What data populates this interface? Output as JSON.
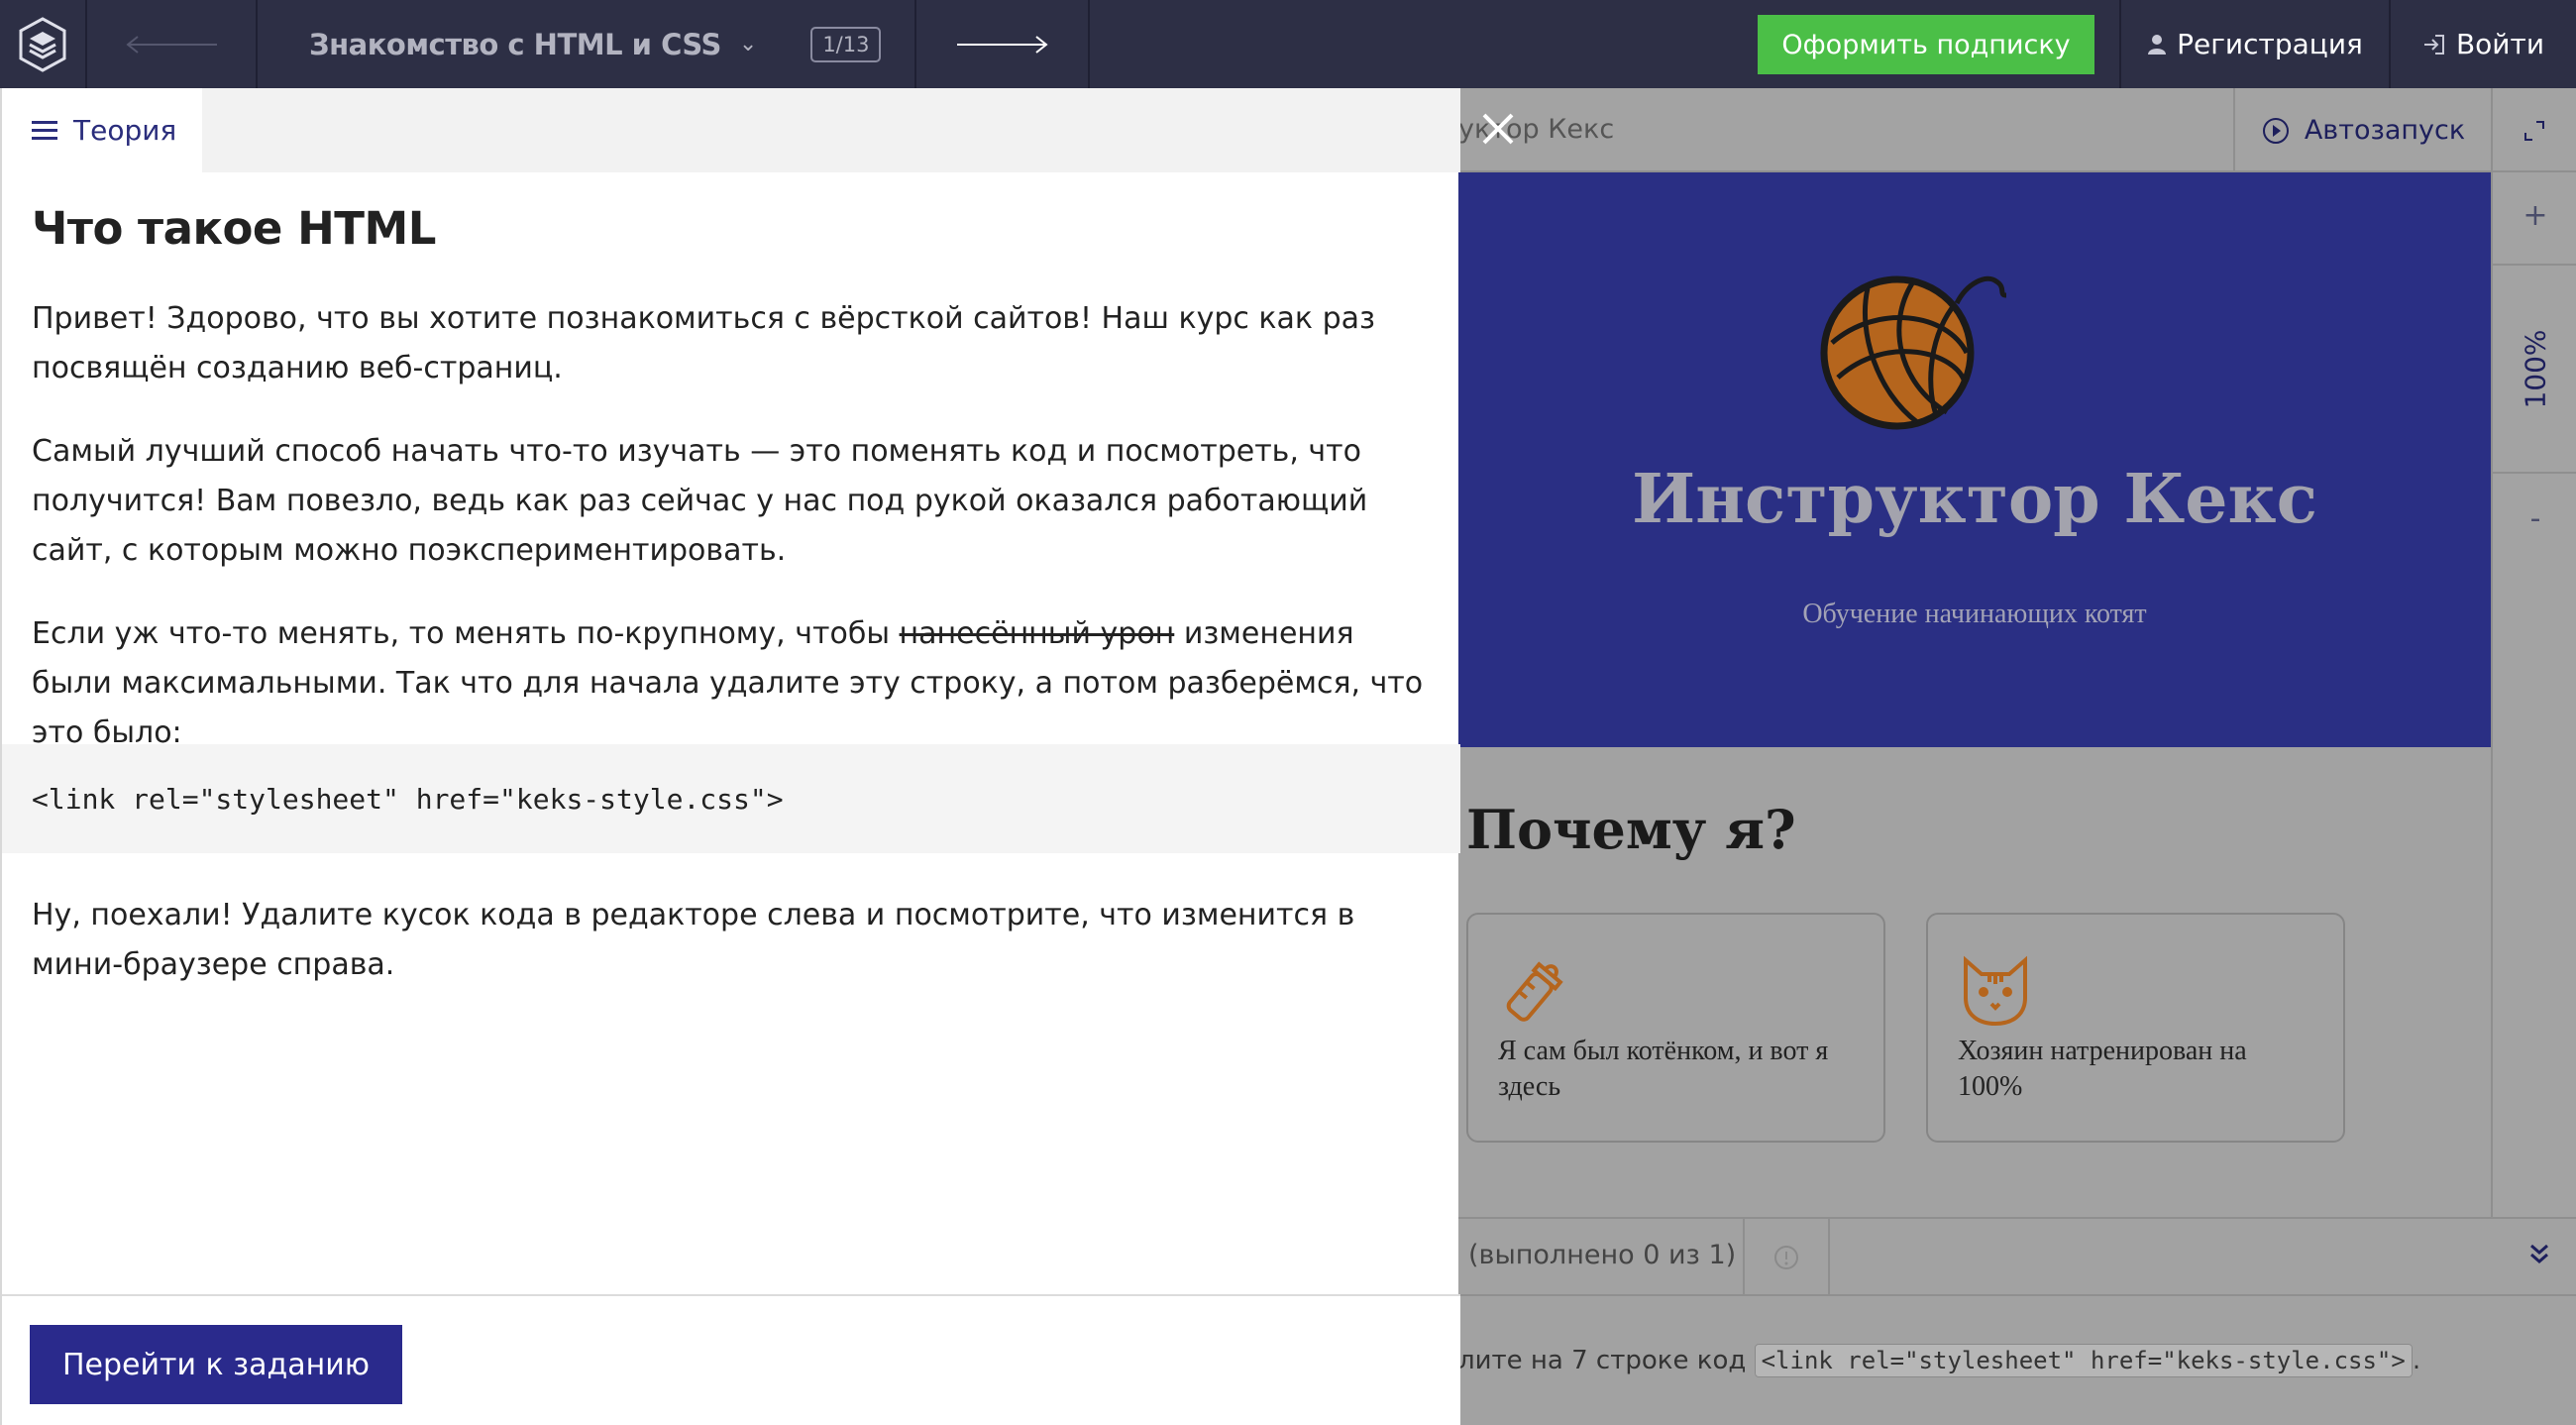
{
  "topbar": {
    "course_title": "Знакомство с HTML и CSS",
    "counter": "1/13",
    "subscribe_label": "Оформить подписку",
    "register_label": "Регистрация",
    "login_label": "Войти"
  },
  "theory": {
    "tab_label": "Теория",
    "heading": "Что такое HTML",
    "p1": "Привет! Здорово, что вы хотите познакомиться с вёрсткой сайтов! Наш курс как раз посвящён созданию веб-страниц.",
    "p2": "Самый лучший способ начать что-то изучать — это поменять код и посмотреть, что получится! Вам повезло, ведь как раз сейчас у нас под рукой оказался работающий сайт, с которым можно поэкспериментировать.",
    "p3_before": "Если уж что-то менять, то менять по-крупному, чтобы ",
    "p3_strike": "нанесённый урон",
    "p3_after": " изменения были максимальными. Так что для начала удалите эту строку, а потом разберёмся, что это было:",
    "code": "<link rel=\"stylesheet\" href=\"keks-style.css\">",
    "p4": "Ну, поехали! Удалите кусок кода в редакторе слева и посмотрите, что изменится в мини-браузере справа.",
    "go_task_label": "Перейти к заданию"
  },
  "preview": {
    "tab_label": "уктор Кекс",
    "autorun_label": "Автозапуск",
    "zoom_plus": "+",
    "zoom_value": "100%",
    "zoom_minus": "-",
    "hero_title": "Инструктор Кекс",
    "hero_subtitle": "Обучение начинающих котят",
    "why_heading": "Почему я?",
    "cards": [
      {
        "text": "Я сам был котёнком, и вот я здесь"
      },
      {
        "text": "Хозяин натренирован на 100%"
      }
    ],
    "progress_text": "(выполнено 0 из 1)",
    "task_text": "лите на 7 строке код",
    "task_code": "<link rel=\"stylesheet\" href=\"keks-style.css\">",
    "task_end": "."
  },
  "colors": {
    "topbar_bg": "#2d2f45",
    "subscribe_green": "#4bbf47",
    "accent_indigo": "#2a2a8c",
    "hero_blue": "#2a2f84",
    "yarn_orange": "#b5651d"
  },
  "icons": [
    "logo-icon",
    "arrow-left-icon",
    "chevron-down-icon",
    "arrow-right-icon",
    "user-icon",
    "login-icon",
    "menu-icon",
    "close-icon",
    "play-icon",
    "expand-icon",
    "yarn-ball-icon",
    "baby-bottle-icon",
    "cat-face-icon",
    "info-icon",
    "double-chevron-down-icon"
  ]
}
